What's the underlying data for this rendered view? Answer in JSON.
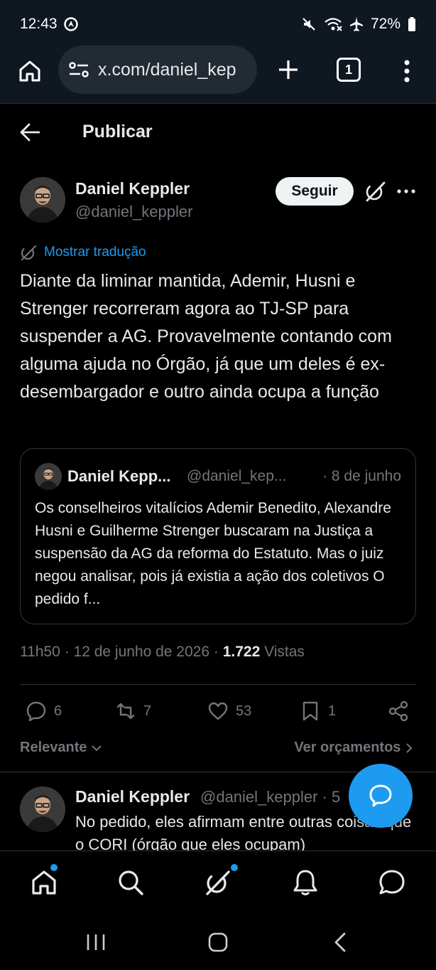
{
  "status_bar": {
    "time": "12:43",
    "battery": "72%"
  },
  "browser": {
    "url": "x.com/daniel_kep",
    "tab_count": "1"
  },
  "header": {
    "title": "Publicar"
  },
  "tweet": {
    "author_name": "Daniel Keppler",
    "author_handle": "@daniel_keppler",
    "follow_label": "Seguir",
    "translate_label": "Mostrar tradução",
    "text": "Diante da liminar mantida, Ademir, Husni e Strenger recorreram agora ao TJ-SP para suspender a AG. Provavelmente contando com alguma ajuda no Órgão, já que um deles é ex-desembargador e outro ainda ocupa a função",
    "time": "11h50",
    "date": "12 de junho de 2026",
    "views_count": "1.722",
    "views_label": "Vistas"
  },
  "quote": {
    "author_name": "Daniel Kepp...",
    "author_handle": "@daniel_kep...",
    "date": "· 8 de junho",
    "text": "Os conselheiros vitalícios Ademir Benedito, Alexandre Husni e Guilherme Strenger buscaram na Justiça a suspensão da AG da reforma do Estatuto. Mas o juiz negou analisar, pois já existia a ação dos coletivos O pedido f..."
  },
  "actions": {
    "replies": "6",
    "reposts": "7",
    "likes": "53",
    "bookmarks": "1"
  },
  "sort": {
    "left_label": "Relevante",
    "right_label": "Ver orçamentos"
  },
  "reply": {
    "author_name": "Daniel Keppler",
    "author_handle": "@daniel_keppler · 5",
    "text": "No pedido, eles afirmam entre outras coisas que o CORI (órgão que eles ocupam)"
  },
  "colors": {
    "accent": "#1d9bf0",
    "background": "#000000",
    "text_primary": "#e7e9ea",
    "text_secondary": "#71767b"
  }
}
